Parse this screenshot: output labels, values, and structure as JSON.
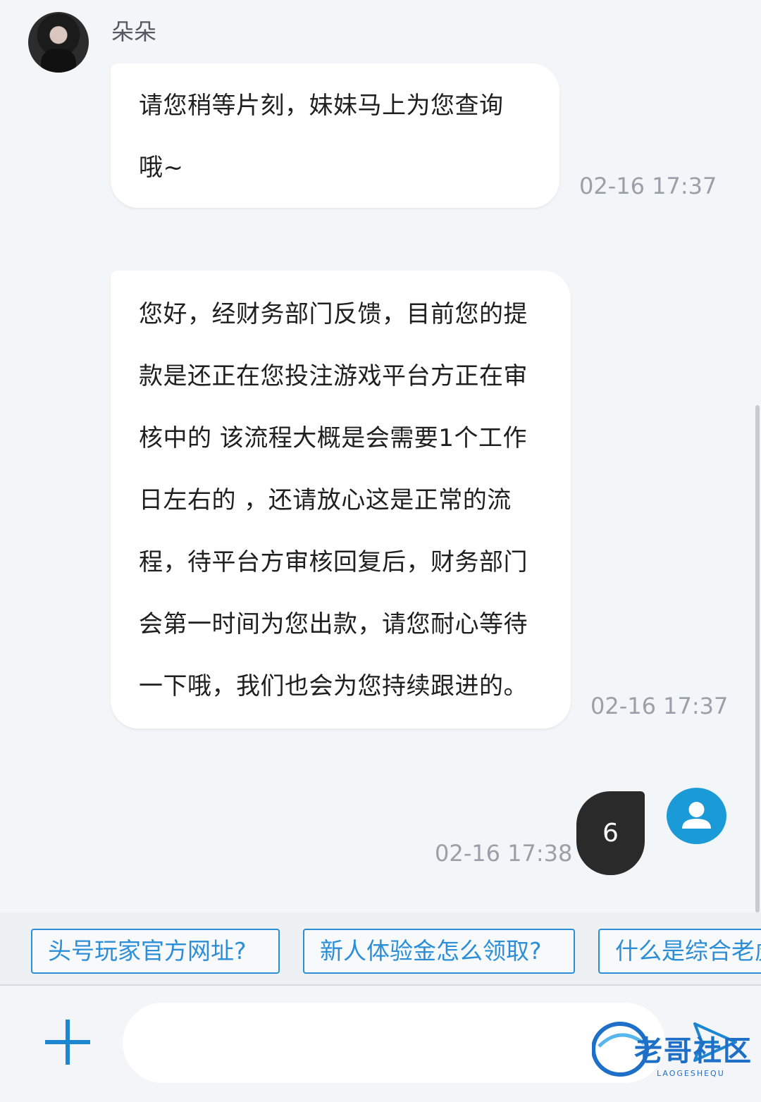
{
  "agent": {
    "name": "朵朵"
  },
  "messages": [
    {
      "sender": "agent",
      "lines": [
        "请您稍等片刻，妹妹马上为您查询",
        "哦~"
      ],
      "time": "02-16 17:37"
    },
    {
      "sender": "agent",
      "lines": [
        "您好，经财务部门反馈，目前您的提",
        "款是还正在您投注游戏平台方正在审",
        "核中的  该流程大概是会需要1个工作",
        "日左右的 ，还请放心这是正常的流",
        "程，待平台方审核回复后，财务部门",
        "会第一时间为您出款，请您耐心等待",
        "一下哦，我们也会为您持续跟进的。"
      ],
      "time": "02-16 17:37"
    },
    {
      "sender": "user",
      "text": "6",
      "time": "02-16 17:38"
    }
  ],
  "quick_replies": [
    "头号玩家官方网址?",
    "新人体验金怎么领取?",
    "什么是综合老虎"
  ],
  "input": {
    "placeholder": ""
  },
  "icons": {
    "attach": "plus-icon",
    "send": "send-icon",
    "user_avatar": "user-avatar-icon"
  },
  "watermark": {
    "text": "老哥社区",
    "sub": "LAOGESHEQU"
  },
  "colors": {
    "accent": "#1d86d0",
    "user_bubble": "#2a2a2a",
    "user_avatar": "#1a9ad6",
    "background": "#f3f6f9"
  }
}
